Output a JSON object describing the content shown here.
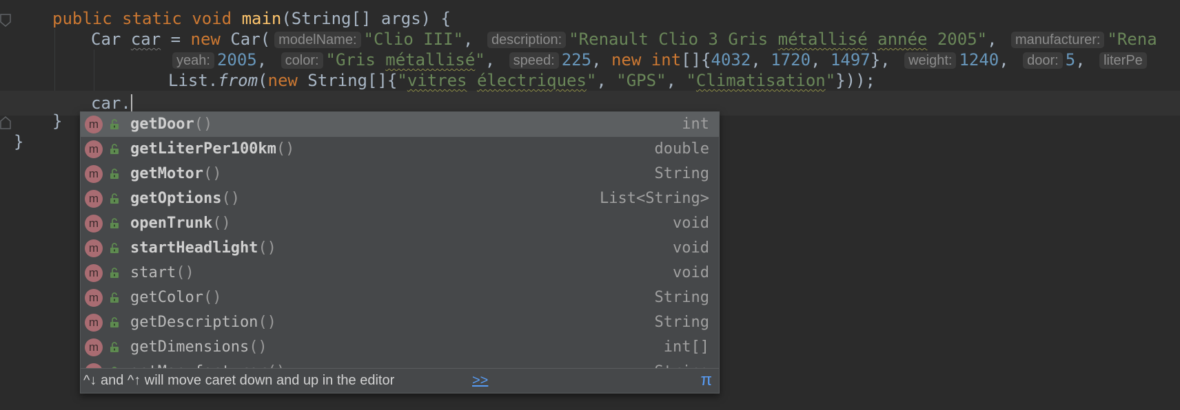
{
  "editor": {
    "line1": {
      "k1": "public",
      "k2": "static",
      "k3": "void",
      "method": "main",
      "params": "(String[] args) {"
    },
    "line2": {
      "type": "Car",
      "var": "car",
      "eq": "=",
      "kw_new": "new",
      "ctor": "Car(",
      "hint_modelName": "modelName:",
      "val_modelName": "\"Clio III\"",
      "hint_description": "description:",
      "val_description_a": "\"Renault Clio 3 Gris ",
      "val_description_b": "métallisé",
      "val_description_c": " ",
      "val_description_d": "année",
      "val_description_e": " 2005\"",
      "hint_manufacturer": "manufacturer:",
      "val_manufacturer": "\"Rena"
    },
    "line3": {
      "hint_yeah": "yeah:",
      "val_yeah": "2005",
      "hint_color": "color:",
      "val_color_a": "\"Gris ",
      "val_color_b": "métallisé",
      "val_color_c": "\"",
      "hint_speed": "speed:",
      "val_speed": "225",
      "kw_new": "new",
      "kw_int": "int",
      "arr_open": "[]{",
      "dim1": "4032",
      "dim2": "1720",
      "dim3": "1497",
      "arr_close": "},",
      "hint_weight": "weight:",
      "val_weight": "1240",
      "hint_door": "door:",
      "val_door": "5",
      "hint_literPer": "literPe"
    },
    "line4": {
      "list": "List.",
      "from": "from",
      "paren": "(",
      "kw_new": "new",
      "strarr": " String[]{",
      "opt1_a": "\"",
      "opt1_b": "vitres",
      "opt1_c": " ",
      "opt1_d": "électriques",
      "opt1_e": "\"",
      "opt2": "\"GPS\"",
      "opt3_a": "\"",
      "opt3_b": "Climatisation",
      "opt3_c": "\"",
      "close": "}));"
    },
    "line5": {
      "text": "car."
    },
    "line6": {
      "text": "}"
    },
    "line7": {
      "text": "}"
    }
  },
  "completion": {
    "items": [
      {
        "name": "getDoor",
        "parens": "()",
        "type": "int",
        "bold": true,
        "selected": true
      },
      {
        "name": "getLiterPer100km",
        "parens": "()",
        "type": "double",
        "bold": true
      },
      {
        "name": "getMotor",
        "parens": "()",
        "type": "String",
        "bold": true
      },
      {
        "name": "getOptions",
        "parens": "()",
        "type": "List<String>",
        "bold": true
      },
      {
        "name": "openTrunk",
        "parens": "()",
        "type": "void",
        "bold": true
      },
      {
        "name": "startHeadlight",
        "parens": "()",
        "type": "void",
        "bold": true
      },
      {
        "name": "start",
        "parens": "()",
        "type": "void",
        "bold": false
      },
      {
        "name": "getColor",
        "parens": "()",
        "type": "String",
        "bold": false
      },
      {
        "name": "getDescription",
        "parens": "()",
        "type": "String",
        "bold": false
      },
      {
        "name": "getDimensions",
        "parens": "()",
        "type": "int[]",
        "bold": false
      },
      {
        "name": "getManufacturer",
        "parens": "()",
        "type": "String",
        "bold": false
      }
    ],
    "icon_letter": "m",
    "status_text": "^↓ and ^↑ will move caret down and up in the editor",
    "status_link": ">>",
    "status_pi": "π"
  }
}
